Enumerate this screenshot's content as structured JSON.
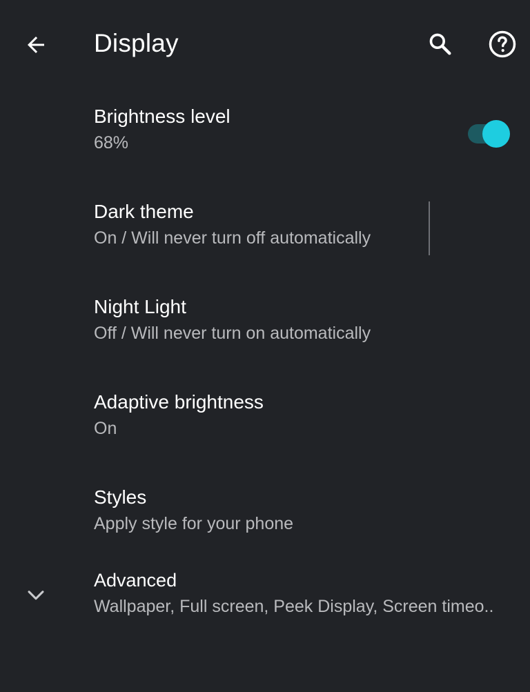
{
  "appbar": {
    "title": "Display",
    "back_icon": "arrow-back-icon",
    "search_icon": "search-icon",
    "help_icon": "help-icon"
  },
  "settings": {
    "brightness": {
      "title": "Brightness level",
      "summary": "68%"
    },
    "dark_theme": {
      "title": "Dark theme",
      "summary": "On / Will never turn off automatically",
      "enabled": true
    },
    "night_light": {
      "title": "Night Light",
      "summary": "Off / Will never turn on automatically"
    },
    "adaptive_brightness": {
      "title": "Adaptive brightness",
      "summary": "On"
    },
    "styles": {
      "title": "Styles",
      "summary": "Apply style for your phone"
    },
    "advanced": {
      "title": "Advanced",
      "summary": "Wallpaper, Full screen, Peek Display, Screen timeo..",
      "icon": "chevron-down-icon"
    }
  },
  "colors": {
    "background": "#212327",
    "accent": "#1ecde0",
    "accent_track": "#1d5a61",
    "secondary_text": "#b9babd"
  }
}
